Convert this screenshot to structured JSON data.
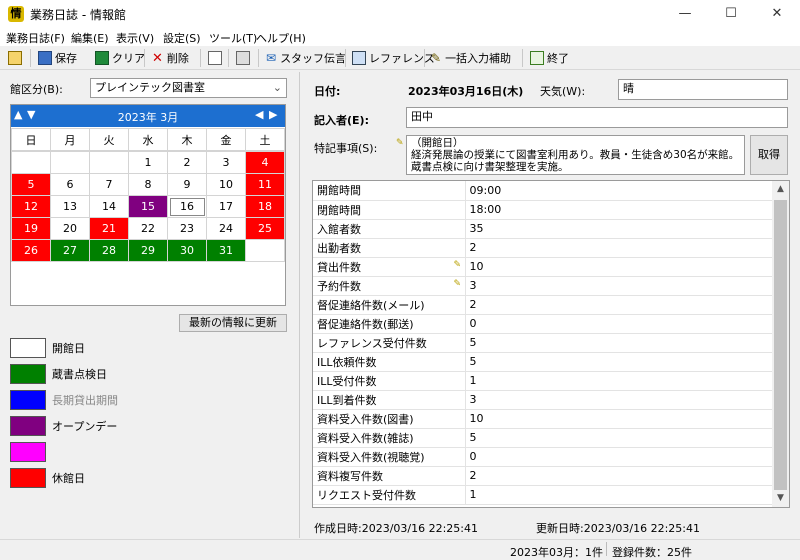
{
  "window": {
    "title": "業務日誌 - 情報館",
    "minimize": "—",
    "maximize": "☐",
    "close": "✕"
  },
  "menu": [
    "業務日誌(F)",
    "編集(E)",
    "表示(V)",
    "設定(S)",
    "ツール(T)",
    "ヘルプ(H)"
  ],
  "toolbar": {
    "save": "保存",
    "clear": "クリア",
    "delete": "削除",
    "staff": "スタッフ伝言",
    "reference": "レファレンス",
    "bulk": "一括入力補助",
    "exit": "終了"
  },
  "left": {
    "branch_label": "館区分(B):",
    "branch_value": "プレインテック図書室",
    "calendar": {
      "month": "2023年 3月",
      "weekdays": [
        "日",
        "月",
        "火",
        "水",
        "木",
        "金",
        "土"
      ],
      "weeks": [
        [
          "",
          "",
          "",
          "1",
          "2",
          "3",
          "4"
        ],
        [
          "5",
          "6",
          "7",
          "8",
          "9",
          "10",
          "11"
        ],
        [
          "12",
          "13",
          "14",
          "15",
          "16",
          "17",
          "18"
        ],
        [
          "19",
          "20",
          "21",
          "22",
          "23",
          "24",
          "25"
        ],
        [
          "26",
          "27",
          "28",
          "29",
          "30",
          "31",
          ""
        ]
      ],
      "selected_day": "16"
    },
    "refresh_button": "最新の情報に更新",
    "legend": [
      {
        "label": "開館日",
        "color": "#ffffff"
      },
      {
        "label": "蔵書点検日",
        "color": "#008000"
      },
      {
        "label": "長期貸出期間",
        "color": "#0000ff"
      },
      {
        "label": "オープンデー",
        "color": "#800080"
      },
      {
        "label": "",
        "color": "#ff00ff"
      },
      {
        "label": "休館日",
        "color": "#ff0000"
      }
    ]
  },
  "right": {
    "date_label": "日付:",
    "date_value": "2023年03月16日(木)",
    "weather_label": "天気(W):",
    "weather_value": "晴",
    "recorder_label": "記入者(E):",
    "recorder_value": "田中",
    "notes_label": "特記事項(S):",
    "notes_lines": [
      "（開館日）",
      "経済発展論の授業にて図書室利用あり。教員・生徒含め30名が来館。",
      "蔵書点検に向け書架整理を実施。"
    ],
    "fetch_button": "取得",
    "rows": [
      {
        "name": "開館時間",
        "value": "09:00",
        "edited": false
      },
      {
        "name": "閉館時間",
        "value": "18:00",
        "edited": false
      },
      {
        "name": "入館者数",
        "value": "35",
        "edited": false
      },
      {
        "name": "出勤者数",
        "value": "2",
        "edited": false
      },
      {
        "name": "貸出件数",
        "value": "10",
        "edited": true
      },
      {
        "name": "予約件数",
        "value": "3",
        "edited": true
      },
      {
        "name": "督促連絡件数(メール)",
        "value": "2",
        "edited": false
      },
      {
        "name": "督促連絡件数(郵送)",
        "value": "0",
        "edited": false
      },
      {
        "name": "レファレンス受付件数",
        "value": "5",
        "edited": false
      },
      {
        "name": "ILL依頼件数",
        "value": "5",
        "edited": false
      },
      {
        "name": "ILL受付件数",
        "value": "1",
        "edited": false
      },
      {
        "name": "ILL到着件数",
        "value": "3",
        "edited": false
      },
      {
        "name": "資料受入件数(図書)",
        "value": "10",
        "edited": false
      },
      {
        "name": "資料受入件数(雑誌)",
        "value": "5",
        "edited": false
      },
      {
        "name": "資料受入件数(視聴覚)",
        "value": "0",
        "edited": false
      },
      {
        "name": "資料複写件数",
        "value": "2",
        "edited": false
      },
      {
        "name": "リクエスト受付件数",
        "value": "1",
        "edited": false
      }
    ],
    "created": "作成日時:2023/03/16 22:25:41",
    "updated": "更新日時:2023/03/16 22:25:41"
  },
  "status": {
    "month": "2023年03月：1件",
    "total": "登録件数：25件"
  }
}
